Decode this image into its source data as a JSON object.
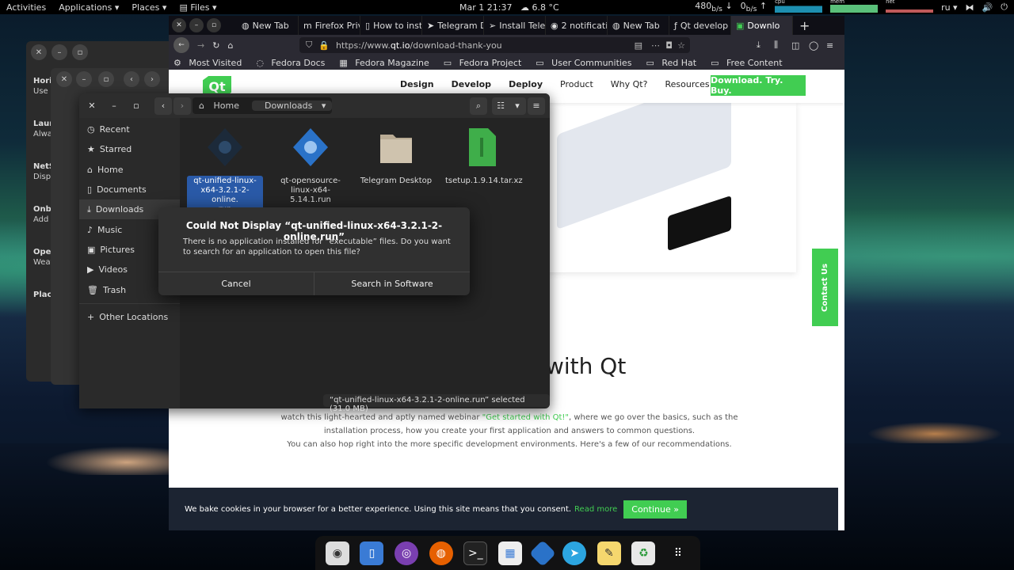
{
  "topbar": {
    "activities": "Activities",
    "applications": "Applications",
    "places": "Places",
    "files": "Files",
    "clock": "Mar 1  21:37",
    "weather": "6.8 °C",
    "net_down": "480",
    "net_up": "0",
    "cpu_label": "cpu",
    "mem_label": "mem",
    "net_label": "net",
    "lang": "ru"
  },
  "bgwindow": {
    "labels": [
      {
        "title": "Horiz",
        "sub": "Use a"
      },
      {
        "title": "Launc",
        "sub": "Alwa"
      },
      {
        "title": "NetS",
        "sub": "Displ"
      },
      {
        "title": "Onbo",
        "sub": "Add i"
      },
      {
        "title": "Open",
        "sub": "Weat darks"
      },
      {
        "title": "Place",
        "sub": ""
      }
    ]
  },
  "firefox": {
    "tabs": [
      "New Tab",
      "Firefox Priv",
      "How to inst",
      "Telegram D",
      "Install Tele",
      "2 notificati",
      "New Tab",
      "Qt develop",
      "Downlo"
    ],
    "url_prefix": "https://www.",
    "url_host": "qt.io",
    "url_path": "/download-thank-you",
    "bookmarks": [
      "Most Visited",
      "Fedora Docs",
      "Fedora Magazine",
      "Fedora Project",
      "User Communities",
      "Red Hat",
      "Free Content"
    ],
    "page": {
      "logo": "Qt",
      "menu": [
        "Design",
        "Develop",
        "Deploy",
        "Product",
        "Why Qt?",
        "Resources"
      ],
      "cta": "Download. Try. Buy.",
      "contact": "Contact Us",
      "heading": "with Qt",
      "para1_a": "watch this light-hearted and aptly named webinar ",
      "para1_link": "\"Get started with Qt!\"",
      "para1_b": ", where we go over the basics, such as the installation process, how you create your first application and answers to common questions.",
      "para2": "You can also hop right into the more specific development environments. Here's a few of our recommendations.",
      "cookie_text": "We bake cookies in your browser for a better experience. Using this site means that you consent.",
      "cookie_link": "Read more",
      "cookie_button": "Continue »"
    }
  },
  "files": {
    "path": [
      "Home",
      "Downloads"
    ],
    "sidebar": [
      "Recent",
      "Starred",
      "Home",
      "Documents",
      "Downloads",
      "Music",
      "Pictures",
      "Videos",
      "Trash"
    ],
    "other": "Other Locations",
    "items": [
      {
        "name": "qt-unified-linux-x64-3.2.1-2-online.run",
        "lines": [
          "qt-unified-linux-",
          "x64-3.2.1-2-online.",
          "run"
        ],
        "selected": true
      },
      {
        "name": "qt-opensource-linux-x64-5.14.1.run",
        "lines": [
          "qt-opensource-",
          "linux-x64-5.14.1.run"
        ],
        "selected": false
      },
      {
        "name": "Telegram Desktop",
        "lines": [
          "Telegram Desktop"
        ],
        "selected": false
      },
      {
        "name": "tsetup.1.9.14.tar.xz",
        "lines": [
          "tsetup.1.9.14.tar.xz"
        ],
        "selected": false
      }
    ],
    "status": "“qt-unified-linux-x64-3.2.1-2-online.run” selected  (31.0 MB)"
  },
  "dialog": {
    "title": "Could Not Display “qt-unified-linux-x64-3.2.1-2-online.run”",
    "body": "There is no application installed for “executable” files. Do you want to search for an application to open this file?",
    "cancel": "Cancel",
    "search": "Search in Software"
  },
  "dock": [
    "vinyl-icon",
    "files-icon",
    "tor-icon",
    "firefox-icon",
    "terminal-icon",
    "store-icon",
    "qt-icon",
    "telegram-icon",
    "notes-icon",
    "trash-icon",
    "apps-grid-icon"
  ],
  "colors": {
    "qt_green": "#41cd52",
    "selection": "#2a5aa8"
  }
}
